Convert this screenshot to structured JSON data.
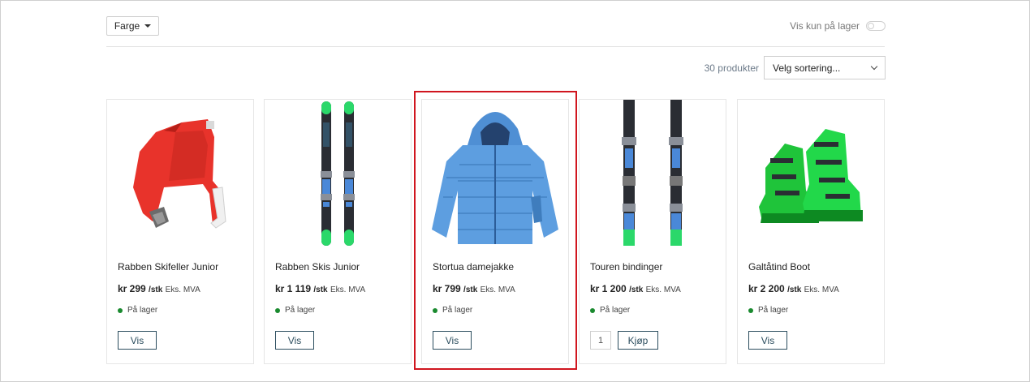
{
  "filters": {
    "color_label": "Farge",
    "stock_only_label": "Vis kun på lager",
    "stock_only_on": false
  },
  "listing": {
    "count_text": "30 produkter",
    "sort_placeholder": "Velg sortering..."
  },
  "products": [
    {
      "name": "Rabben Skifeller Junior",
      "price": "kr 299",
      "unit": "/stk",
      "vat": "Eks. MVA",
      "stock": "På lager",
      "button": "Vis",
      "image": "climbing-skins-icon"
    },
    {
      "name": "Rabben Skis Junior",
      "price": "kr 1 119",
      "unit": "/stk",
      "vat": "Eks. MVA",
      "stock": "På lager",
      "button": "Vis",
      "image": "skis-icon"
    },
    {
      "name": "Stortua damejakke",
      "price": "kr 799",
      "unit": "/stk",
      "vat": "Eks. MVA",
      "stock": "På lager",
      "button": "Vis",
      "image": "jacket-icon"
    },
    {
      "name": "Touren bindinger",
      "price": "kr 1 200",
      "unit": "/stk",
      "vat": "Eks. MVA",
      "stock": "På lager",
      "button": "Kjøp",
      "qty": "1",
      "image": "ski-bindings-icon"
    },
    {
      "name": "Galtåtind Boot",
      "price": "kr 2 200",
      "unit": "/stk",
      "vat": "Eks. MVA",
      "stock": "På lager",
      "button": "Vis",
      "image": "ski-boot-icon"
    }
  ],
  "colors": {
    "accent": "#2b4d5e",
    "in_stock": "#1a8a2f",
    "highlight": "#d0161f"
  }
}
